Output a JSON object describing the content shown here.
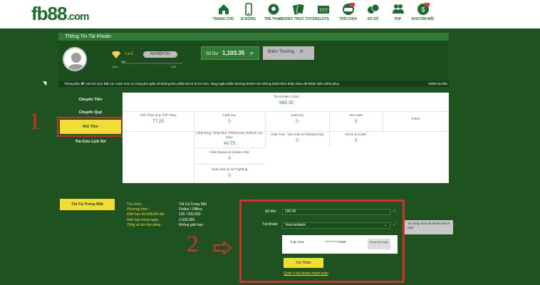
{
  "header": {
    "logo_main": "fb88",
    "logo_domain": ".com",
    "nav": [
      {
        "label": "TRANG CHỦ",
        "icon": "home-icon"
      },
      {
        "label": "DI ĐỘNG",
        "icon": "mobile-icon"
      },
      {
        "label": "THỂ THAO",
        "icon": "soccer-icon"
      },
      {
        "label": "CASINO TRỰC TUYẾN",
        "icon": "cards-icon"
      },
      {
        "label": "SLOTS",
        "icon": "slot-icon"
      },
      {
        "label": "TRÒ CHƠI",
        "icon": "game-icon"
      },
      {
        "label": "XỔ SỐ",
        "icon": "lottery-icon"
      },
      {
        "label": "P2P",
        "icon": "people-icon"
      },
      {
        "label": "KHUYẾN MÃI",
        "icon": "promo-icon"
      }
    ]
  },
  "account": {
    "title": "Thông Tin Tài Khoản",
    "level": "Lv.1",
    "level_button": "NGHIỆP DƯ",
    "progress_label": "0%",
    "progress": 0,
    "lv_start": "Lv.1",
    "lv_end": "Lv.2",
    "balance_label": "Số Dư",
    "balance_value": "1,103.35",
    "bonus_label": "Điểm Thưởng"
  },
  "notice": {
    "label": "Thông Báo",
    "text": "Anh trò chơi Bắn cá. Cách chơi vô cùng đơn giản và không kém phần thú vị từ trò chơi, hàng ngàn phần thưởng đi kèm với những thách thức khác nhau để thành viên chinh phục.",
    "right": "FB88 xin hân"
  },
  "sidebar": {
    "items": [
      "Chuyển Tiền",
      "Chuyển Quỹ",
      "Rút Tiền",
      "Tra Cứu Lịch Sử"
    ],
    "active_index": 2
  },
  "wallets": {
    "main_label": "Tài Khoản Chính",
    "main_value": "985.35",
    "cells": [
      {
        "label": "Thể Thao & E Thể Thao",
        "value": "77.25"
      },
      {
        "label": "Club Ace",
        "value": "0"
      },
      {
        "label": "Club Koi",
        "value": "0"
      },
      {
        "label": "VN Lotto",
        "value": "0"
      },
      {
        "label": "Poker",
        "value": ""
      },
      {
        "label": "Club King, King Slot, Fisherman Gold & Lux Dice",
        "value": "40.75"
      },
      {
        "label": "Club Tien, Tien Slot & Fishing King",
        "value": "0"
      },
      {
        "label": "Keno & iLotto",
        "value": "0"
      },
      {
        "label": "Club Queen & Queen Slot",
        "value": "0"
      },
      {
        "label": "Club Jack & Air Fighting",
        "value": "0"
      }
    ]
  },
  "method": {
    "all_button": "Tất Cả Trong Một",
    "rows": [
      {
        "key": "Tùy chọn :",
        "value": "Tất Cả Trong Một"
      },
      {
        "key": "Phương thức :",
        "value": "Online / Offline"
      },
      {
        "key": "Giới hạn tối thiểu/tối đa :",
        "value": "100 / 200,000"
      },
      {
        "key": "Giới hạn trong ngày :",
        "value": "2,000,000"
      },
      {
        "key": "Tổng số dư cho phép :",
        "value": "Không giới hạn"
      }
    ]
  },
  "withdraw_form": {
    "amount_label": "Số tiền",
    "amount_value": "100.00",
    "account_label": "Tài khoản",
    "account_value": "Vietcombank",
    "tooltip": "Vui lòng chọn tài khoản thanh toán",
    "holder_name": "iLily Hoa",
    "account_number": "**********4488",
    "change_button": "Chọn tài khoản",
    "confirm_button": "Xác Nhận",
    "manage_link": "Quản lí tài khoản thanh toán"
  },
  "annotations": {
    "step1": "1",
    "step2": "2"
  }
}
